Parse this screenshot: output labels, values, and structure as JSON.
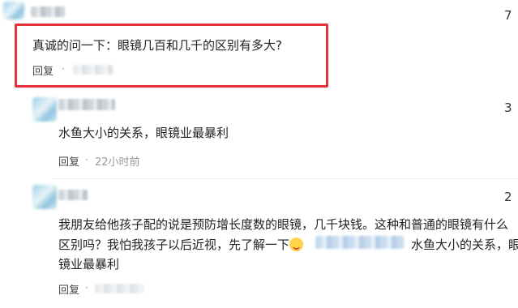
{
  "comments": [
    {
      "count": "7",
      "text": "真诚的问一下：眼镜几百和几千的区别有多大?",
      "reply_label": "回复",
      "dot": "·"
    },
    {
      "count": "3",
      "text": "水鱼大小的关系，眼镜业最暴利",
      "reply_label": "回复",
      "dot": "·",
      "time": "22小时前"
    },
    {
      "count": "2",
      "line1": "我朋友给他孩子配的说是预防增长度数的眼镜，几千块钱。这种和普通的眼镜有什么",
      "line2a": "区别吗？我怕我孩子以后近视，先了解一下",
      "quote": "水鱼大小的关系，眼",
      "line3": "镜业最暴利",
      "reply_label": "回复",
      "dot": "·"
    }
  ],
  "colors": {
    "highlight": "#e5323a",
    "muted": "#999999"
  }
}
